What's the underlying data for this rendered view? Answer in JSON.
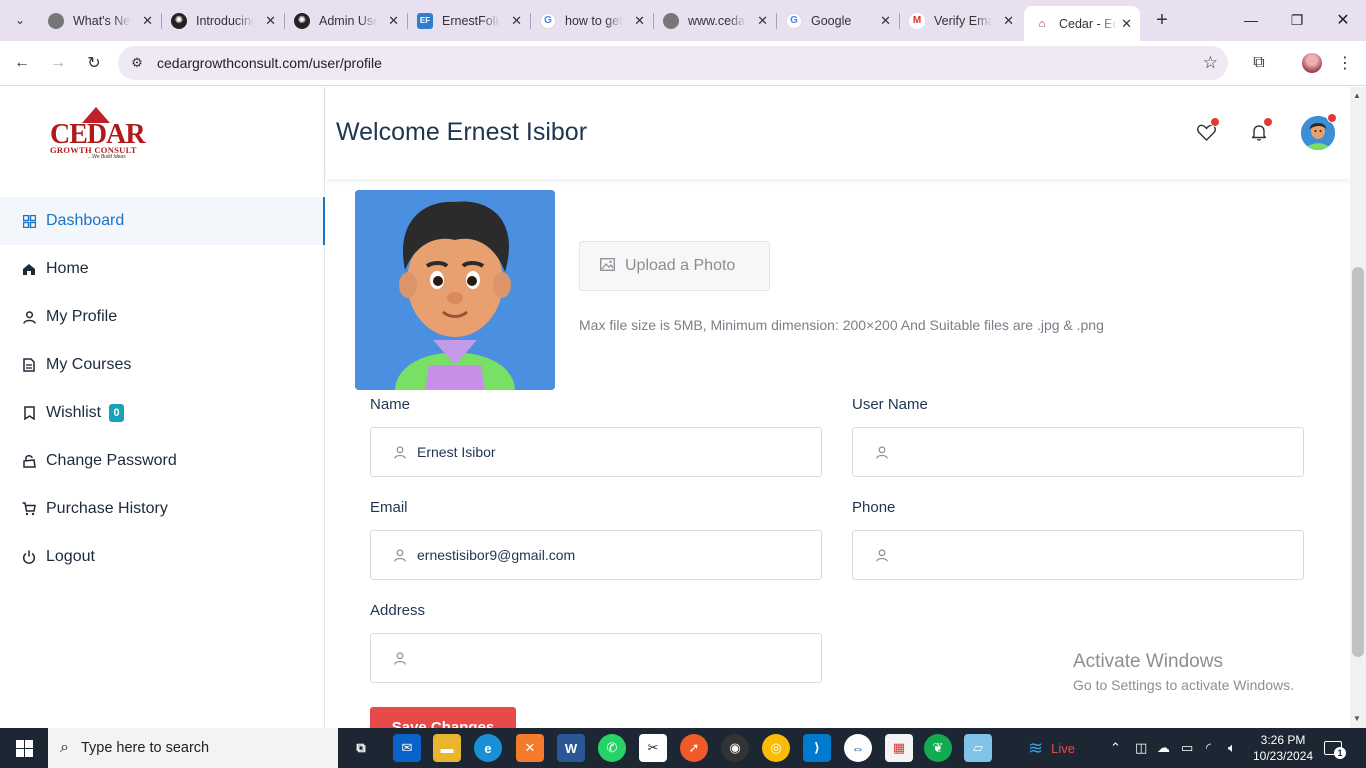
{
  "browser": {
    "tabs": [
      {
        "title": "What's New",
        "color": "#5f6368",
        "letter": "◉"
      },
      {
        "title": "Introducing",
        "color": "#1f1f1f",
        "letter": "✺"
      },
      {
        "title": "Admin Users",
        "color": "#1f1f1f",
        "letter": "✺"
      },
      {
        "title": "ErnestFolio",
        "color": "#2d7dd2",
        "letter": "EF"
      },
      {
        "title": "how to get",
        "color": "#ffffff",
        "letter": "G"
      },
      {
        "title": "www.cedar",
        "color": "#5f6368",
        "letter": "◉"
      },
      {
        "title": "Google",
        "color": "#ffffff",
        "letter": "G"
      },
      {
        "title": "Verify Email",
        "color": "#ffffff",
        "letter": "M"
      },
      {
        "title": "Cedar - Ed",
        "color": "#ffffff",
        "letter": "⌂"
      }
    ],
    "url": "cedargrowthconsult.com/user/profile"
  },
  "logo": {
    "word": "CEDAR",
    "sub": "GROWTH CONSULT",
    "tag": "...We Build Ideas"
  },
  "sidebar": {
    "items": [
      {
        "label": "Dashboard",
        "icon": "grid-icon"
      },
      {
        "label": "Home",
        "icon": "home-icon"
      },
      {
        "label": "My Profile",
        "icon": "user-icon"
      },
      {
        "label": "My Courses",
        "icon": "document-icon"
      },
      {
        "label": "Wishlist",
        "icon": "bookmark-icon",
        "badge": "0"
      },
      {
        "label": "Change Password",
        "icon": "lock-icon"
      },
      {
        "label": "Purchase History",
        "icon": "cart-icon"
      },
      {
        "label": "Logout",
        "icon": "power-icon"
      }
    ]
  },
  "header": {
    "title": "Welcome Ernest Isibor"
  },
  "profile": {
    "upload_label": "Upload a Photo",
    "hint": "Max file size is 5MB, Minimum dimension: 200×200 And Suitable files are .jpg & .png",
    "fields": {
      "name": {
        "label": "Name",
        "value": "Ernest Isibor"
      },
      "username": {
        "label": "User Name",
        "value": ""
      },
      "email": {
        "label": "Email",
        "value": "ernestisibor9@gmail.com"
      },
      "phone": {
        "label": "Phone",
        "value": ""
      },
      "address": {
        "label": "Address",
        "value": ""
      }
    },
    "save_label": "Save Changes"
  },
  "watermark": {
    "line1": "Activate Windows",
    "line2": "Go to Settings to activate Windows."
  },
  "taskbar": {
    "search_placeholder": "Type here to search",
    "weather": "Live",
    "time": "3:26 PM",
    "date": "10/23/2024",
    "notification_count": "1"
  }
}
